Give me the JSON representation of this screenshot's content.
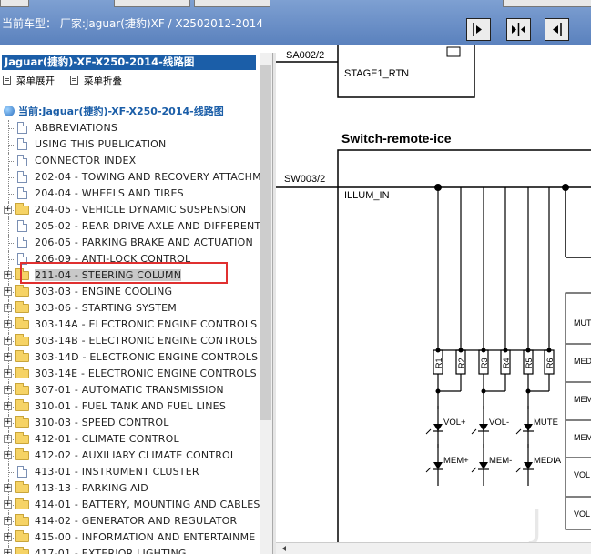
{
  "vehicle_line": "当前车型：  厂家:Jaguar(捷豹)XF / X2502012-2014",
  "tree_header": "Jaguar(捷豹)-XF-X250-2014-线路图",
  "controls": {
    "expand": "菜单展开",
    "collapse": "菜单折叠"
  },
  "root": "当前:Jaguar(捷豹)-XF-X250-2014-线路图",
  "tree_items": [
    {
      "label": "ABBREVIATIONS",
      "kind": "doc"
    },
    {
      "label": "USING THIS PUBLICATION",
      "kind": "doc"
    },
    {
      "label": "CONNECTOR INDEX",
      "kind": "doc"
    },
    {
      "label": "202-04 - TOWING AND RECOVERY ATTACHM",
      "kind": "doc"
    },
    {
      "label": "204-04 - WHEELS AND TIRES",
      "kind": "doc"
    },
    {
      "label": "204-05 - VEHICLE DYNAMIC SUSPENSION",
      "kind": "folder"
    },
    {
      "label": "205-02 - REAR DRIVE AXLE AND DIFFERENT",
      "kind": "doc"
    },
    {
      "label": "206-05 - PARKING BRAKE AND ACTUATION",
      "kind": "doc"
    },
    {
      "label": "206-09 - ANTI-LOCK CONTROL",
      "kind": "doc"
    },
    {
      "label": "211-04 - STEERING COLUMN",
      "kind": "folder",
      "selected": true
    },
    {
      "label": "303-03 - ENGINE COOLING",
      "kind": "folder"
    },
    {
      "label": "303-06 - STARTING SYSTEM",
      "kind": "folder"
    },
    {
      "label": "303-14A - ELECTRONIC ENGINE CONTROLS",
      "kind": "folder"
    },
    {
      "label": "303-14B - ELECTRONIC ENGINE CONTROLS",
      "kind": "folder"
    },
    {
      "label": "303-14D - ELECTRONIC ENGINE CONTROLS",
      "kind": "folder"
    },
    {
      "label": "303-14E - ELECTRONIC ENGINE CONTROLS",
      "kind": "folder"
    },
    {
      "label": "307-01 - AUTOMATIC TRANSMISSION",
      "kind": "folder"
    },
    {
      "label": "310-01 - FUEL TANK AND FUEL LINES",
      "kind": "folder"
    },
    {
      "label": "310-03 - SPEED CONTROL",
      "kind": "folder"
    },
    {
      "label": "412-01 - CLIMATE CONTROL",
      "kind": "folder"
    },
    {
      "label": "412-02 - AUXILIARY CLIMATE CONTROL",
      "kind": "folder"
    },
    {
      "label": "413-01 - INSTRUMENT CLUSTER",
      "kind": "doc"
    },
    {
      "label": "413-13 - PARKING AID",
      "kind": "folder"
    },
    {
      "label": "414-01 - BATTERY, MOUNTING AND CABLES",
      "kind": "folder"
    },
    {
      "label": "414-02 - GENERATOR AND REGULATOR",
      "kind": "folder"
    },
    {
      "label": "415-00 - INFORMATION AND ENTERTAINME",
      "kind": "folder"
    },
    {
      "label": "417-01 - EXTERIOR LIGHTING",
      "kind": "folder"
    }
  ],
  "diagram": {
    "title": "Switch-remote-ice",
    "connector_top": "SA002/2",
    "connector_top_label": "STAGE1_RTN",
    "connector_mid": "SW003/2",
    "connector_mid_label": "ILLUM_IN",
    "resistors": [
      "R1",
      "R2",
      "R3",
      "R4",
      "R5",
      "R6"
    ],
    "leds_row1": [
      "VOL+",
      "VOL-",
      "MUTE"
    ],
    "leds_row2": [
      "MEM+",
      "MEM-",
      "MEDIA"
    ],
    "right_labels": [
      "MUTE",
      "MEDI",
      "MEM",
      "MEM",
      "VOL",
      "VOL"
    ]
  },
  "colors": {
    "topbar": "#6a8fc8",
    "tree_header": "#1b5ea8",
    "highlight": "#e03030"
  }
}
